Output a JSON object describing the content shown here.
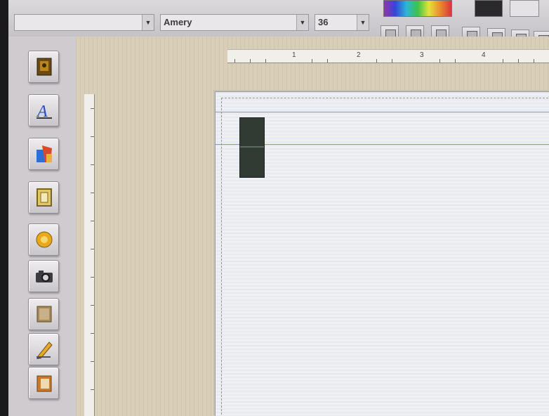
{
  "toolbar": {
    "font_name": "Amery",
    "font_size": "36",
    "buttons": [
      "text-style-icon",
      "align-icon",
      "frame-icon",
      "layout-icon",
      "grid-icon",
      "view-icon",
      "more-icon"
    ]
  },
  "colors": {
    "pasteboard": "#d9cfb8",
    "page": "#eef0f4",
    "guide": "#8a93c9",
    "text_frame": "#2f3b33"
  },
  "ruler": {
    "numbers": [
      "1",
      "2",
      "3",
      "4"
    ]
  },
  "tools": [
    {
      "name": "picture-tool-icon"
    },
    {
      "name": "text-tool-icon"
    },
    {
      "name": "shape-tool-icon"
    },
    {
      "name": "frame-tool-icon"
    },
    {
      "name": "sun-tool-icon"
    },
    {
      "name": "camera-tool-icon"
    },
    {
      "name": "table-tool-icon"
    },
    {
      "name": "pencil-tool-icon"
    },
    {
      "name": "book-tool-icon"
    }
  ]
}
